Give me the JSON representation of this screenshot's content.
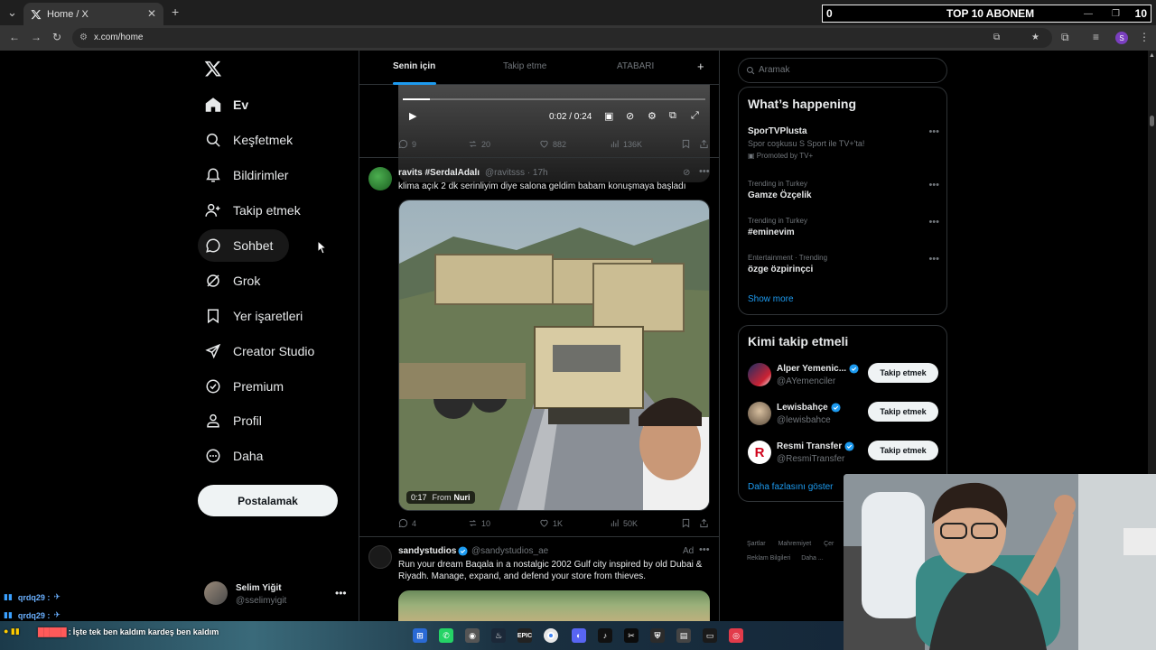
{
  "browser": {
    "tab_title": "Home / X",
    "url": "x.com/home",
    "profile_initial": "S"
  },
  "obs_overlay": {
    "left_value": "0",
    "title": "TOP 10 ABONEM",
    "right_value": "10"
  },
  "nav": {
    "items": [
      {
        "label": "Ev",
        "icon": "home-icon"
      },
      {
        "label": "Keşfetmek",
        "icon": "search-icon"
      },
      {
        "label": "Bildirimler",
        "icon": "bell-icon"
      },
      {
        "label": "Takip etmek",
        "icon": "add-person-icon"
      },
      {
        "label": "Sohbet",
        "icon": "chat-icon"
      },
      {
        "label": "Grok",
        "icon": "grok-icon"
      },
      {
        "label": "Yer işaretleri",
        "icon": "bookmark-icon"
      },
      {
        "label": "Creator Studio",
        "icon": "rocket-icon"
      },
      {
        "label": "Premium",
        "icon": "verified-badge-icon"
      },
      {
        "label": "Profil",
        "icon": "person-icon"
      },
      {
        "label": "Daha",
        "icon": "more-circle-icon"
      }
    ],
    "post_button": "Postalamak",
    "account": {
      "name": "Selim Yiğit",
      "handle": "@sselimyigit"
    }
  },
  "timeline": {
    "tabs": [
      "Senin için",
      "Takip etme",
      "ATABARI"
    ],
    "first_post": {
      "video_time": "0:02 / 0:24",
      "replies": "9",
      "reposts": "20",
      "likes": "882",
      "views": "136K"
    },
    "second_post": {
      "name": "ravits #SerdalAdalı",
      "handle": "@ravitsss · 17h",
      "text": "klima açık 2 dk serinliyim diye salona geldim babam konuşmaya başladı",
      "video_badge_time": "0:17",
      "video_from_label": "From",
      "video_from_name": "Nuri",
      "replies": "4",
      "reposts": "10",
      "likes": "1K",
      "views": "50K"
    },
    "third_post": {
      "name": "sandystudios",
      "handle": "@sandystudios_ae",
      "ad_label": "Ad",
      "text": "Run your dream Baqala in a nostalgic 2002 Gulf city inspired by old Dubai & Riyadh. Manage, expand, and defend your store from thieves."
    }
  },
  "sidebar": {
    "search_placeholder": "Aramak",
    "happening": {
      "title": "What’s happening",
      "trends": [
        {
          "context": "",
          "title": "SporTVPlusta",
          "desc": "Spor coşkusu S Sport ile TV+'ta!",
          "promo": "Promoted by TV+"
        },
        {
          "context": "Trending in Turkey",
          "title": "Gamze Özçelik"
        },
        {
          "context": "Trending in Turkey",
          "title": "#eminevim"
        },
        {
          "context": "Entertainment · Trending",
          "title": "özge özpirinçci"
        }
      ],
      "show_more": "Show more"
    },
    "who_to_follow": {
      "title": "Kimi takip etmeli",
      "accounts": [
        {
          "name": "Alper Yemenic...",
          "handle": "@AYemenciler",
          "button": "Takip etmek"
        },
        {
          "name": "Lewisbahçe",
          "handle": "@lewisbahce",
          "button": "Takip etmek"
        },
        {
          "name": "Resmi Transfer",
          "handle": "@ResmiTransfer",
          "button": "Takip etmek"
        }
      ],
      "show_more": "Daha fazlasını göster"
    },
    "footer": {
      "line1": [
        "Şartlar",
        "Mahremiyet",
        "Çer"
      ],
      "line2": [
        "Reklam Bilgileri",
        "Daha ..."
      ]
    }
  },
  "stream_chat": [
    {
      "user": "qrdq29 :",
      "msg": ""
    },
    {
      "user": "qrdq29 :",
      "msg": ""
    },
    {
      "user": "",
      "msg": "İşte tek ben kaldım kardeş ben kaldım"
    }
  ],
  "colors": {
    "accent": "#1d9bf0",
    "background": "#000000",
    "border": "#2f3336",
    "muted_text": "#71767b"
  }
}
